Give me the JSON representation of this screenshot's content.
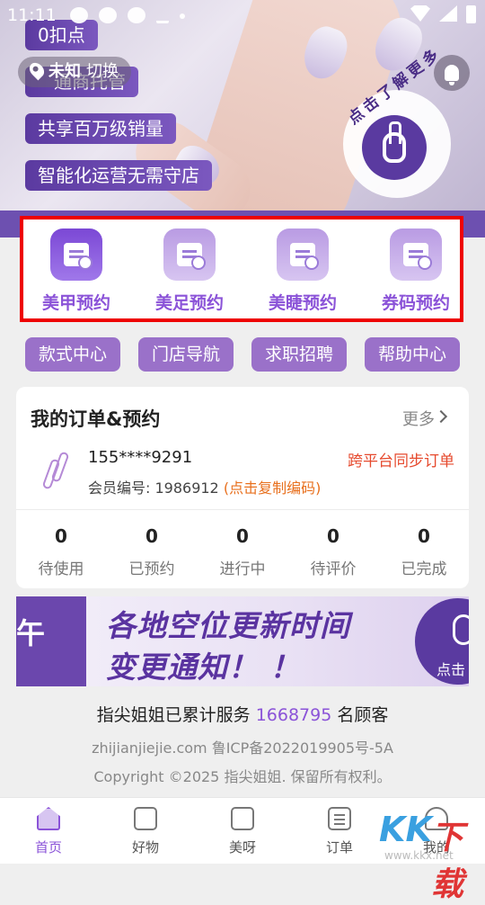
{
  "status_bar": {
    "time": "11:11"
  },
  "hero": {
    "tags": [
      "0扣点",
      "通商托管",
      "共享百万级销量",
      "智能化运营无需守店"
    ],
    "location": {
      "city": "未知",
      "switch": "切换"
    },
    "learn_more": "点击了解更多"
  },
  "booking": {
    "items": [
      {
        "label": "美甲预约"
      },
      {
        "label": "美足预约"
      },
      {
        "label": "美睫预约"
      },
      {
        "label": "券码预约"
      }
    ]
  },
  "quick_links": [
    "款式中心",
    "门店导航",
    "求职招聘",
    "帮助中心"
  ],
  "orders": {
    "title": "我的订单&预约",
    "more": "更多",
    "phone": "155****9291",
    "sync": "跨平台同步订单",
    "member_label": "会员编号: 1986912",
    "member_copy": "(点击复制编码)",
    "stats": [
      {
        "value": "0",
        "label": "待使用"
      },
      {
        "value": "0",
        "label": "已预约"
      },
      {
        "value": "0",
        "label": "进行中"
      },
      {
        "value": "0",
        "label": "待评价"
      },
      {
        "value": "0",
        "label": "已完成"
      }
    ]
  },
  "banner": {
    "left_text": "午",
    "line1": "各地空位更新时间",
    "line2": "变更通知！ ！",
    "cta": "点击"
  },
  "footer": {
    "served_prefix": "指尖姐姐已累计服务",
    "served_count": "1668795",
    "served_suffix": "名顾客",
    "domain": "zhijianjiejie.com   鲁ICP备2022019905号-5A",
    "copyright": "Copyright ©2025 指尖姐姐. 保留所有权利。"
  },
  "tabbar": [
    "首页",
    "好物",
    "美呀",
    "订单",
    "我的"
  ],
  "watermark": {
    "text1": "KK",
    "text2": "下载",
    "url": "www.kkx.net"
  },
  "colors": {
    "brand": "#8b53d8",
    "highlight_border": "#ee0000",
    "accent_orange": "#e8701e"
  }
}
